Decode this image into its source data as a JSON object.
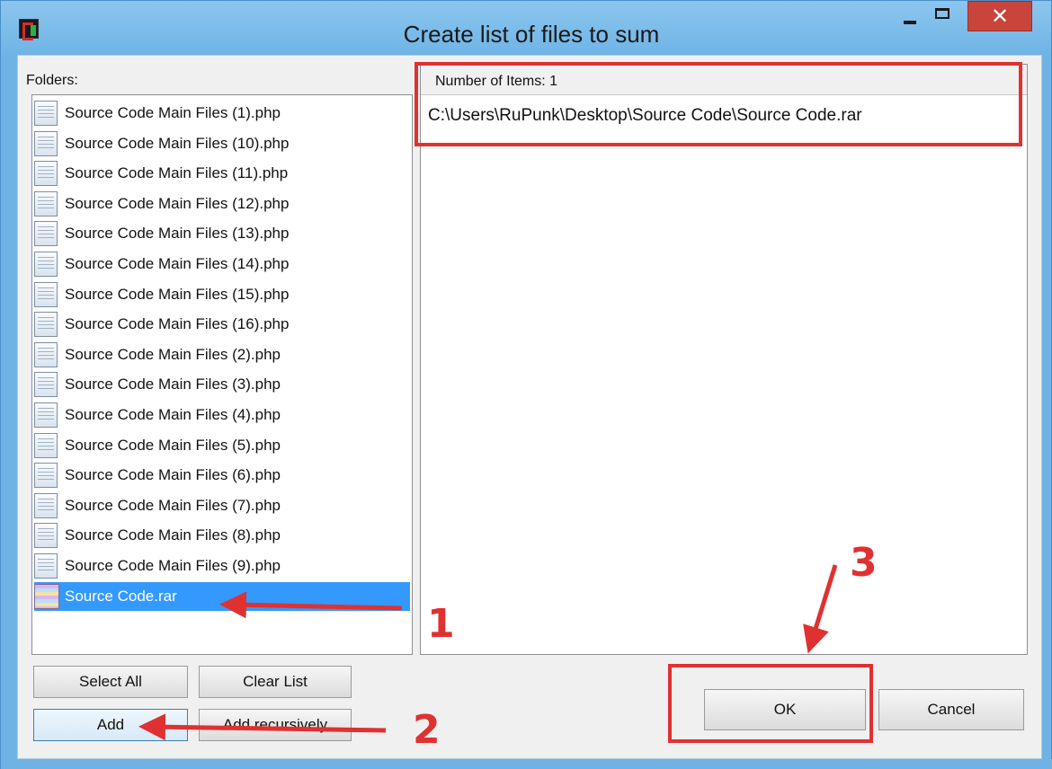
{
  "window": {
    "title": "Create list of files to sum",
    "close_glyph": "✕"
  },
  "left": {
    "label": "Folders:",
    "items": [
      {
        "name": "Source Code Main Files (1).php",
        "icon": "php-file-icon"
      },
      {
        "name": "Source Code Main Files (10).php",
        "icon": "php-file-icon"
      },
      {
        "name": "Source Code Main Files (11).php",
        "icon": "php-file-icon"
      },
      {
        "name": "Source Code Main Files (12).php",
        "icon": "php-file-icon"
      },
      {
        "name": "Source Code Main Files (13).php",
        "icon": "php-file-icon"
      },
      {
        "name": "Source Code Main Files (14).php",
        "icon": "php-file-icon"
      },
      {
        "name": "Source Code Main Files (15).php",
        "icon": "php-file-icon"
      },
      {
        "name": "Source Code Main Files (16).php",
        "icon": "php-file-icon"
      },
      {
        "name": "Source Code Main Files (2).php",
        "icon": "php-file-icon"
      },
      {
        "name": "Source Code Main Files (3).php",
        "icon": "php-file-icon"
      },
      {
        "name": "Source Code Main Files (4).php",
        "icon": "php-file-icon"
      },
      {
        "name": "Source Code Main Files (5).php",
        "icon": "php-file-icon"
      },
      {
        "name": "Source Code Main Files (6).php",
        "icon": "php-file-icon"
      },
      {
        "name": "Source Code Main Files (7).php",
        "icon": "php-file-icon"
      },
      {
        "name": "Source Code Main Files (8).php",
        "icon": "php-file-icon"
      },
      {
        "name": "Source Code Main Files (9).php",
        "icon": "php-file-icon"
      },
      {
        "name": "Source Code.rar",
        "icon": "rar-archive-icon",
        "selected": true
      }
    ]
  },
  "right": {
    "header": "Number of Items: 1",
    "items": [
      "C:\\Users\\RuPunk\\Desktop\\Source Code\\Source Code.rar"
    ]
  },
  "buttons": {
    "select_all": "Select All",
    "clear_list": "Clear List",
    "add": "Add",
    "add_recursively": "Add recursively",
    "ok": "OK",
    "cancel": "Cancel"
  },
  "annotations": {
    "step1": "1",
    "step2": "2",
    "step3": "3",
    "color": "#e03131"
  }
}
